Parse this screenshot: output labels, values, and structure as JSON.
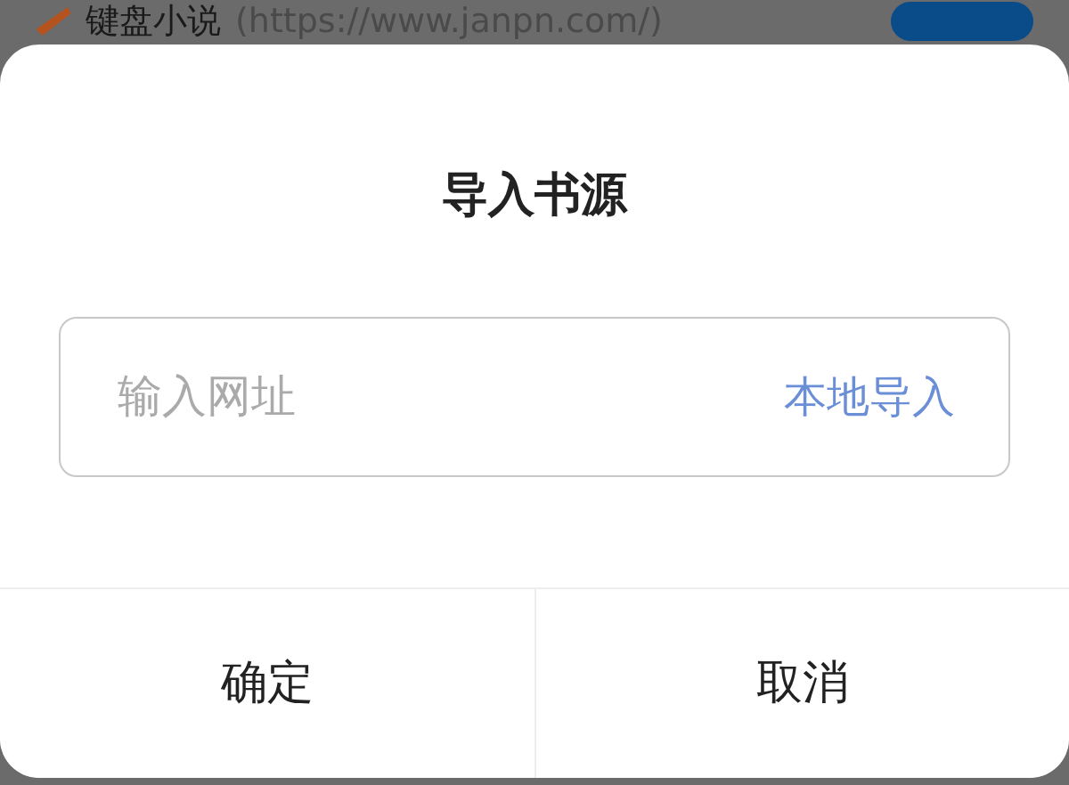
{
  "background_item": {
    "name": "键盘小说",
    "url": "(https://www.janpn.com/)",
    "on": true
  },
  "dialog": {
    "title": "导入书源",
    "url_field": {
      "placeholder": "输入网址"
    },
    "local_import": "本地导入",
    "buttons": [
      {
        "label": "确定"
      },
      {
        "label": "取消"
      }
    ]
  }
}
